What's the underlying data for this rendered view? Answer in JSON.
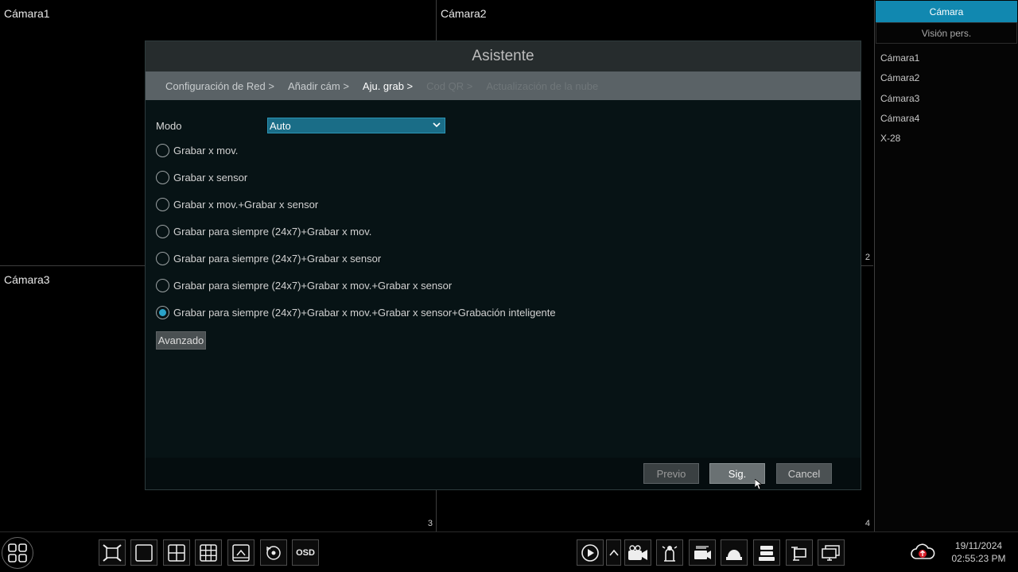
{
  "cameras": [
    {
      "title": "Cámara1",
      "num": ""
    },
    {
      "title": "Cámara2",
      "num": "2"
    },
    {
      "title": "Cámara3",
      "num": "3"
    },
    {
      "title": "",
      "num": "4"
    }
  ],
  "right_panel": {
    "tabs": [
      "Cámara",
      "Visión pers."
    ],
    "items": [
      "Cámara1",
      "Cámara2",
      "Cámara3",
      "Cámara4",
      "X-28"
    ]
  },
  "wizard": {
    "title": "Asistente",
    "steps": [
      {
        "label": "Configuración de Red >",
        "state": "done"
      },
      {
        "label": "Añadir cám >",
        "state": "done"
      },
      {
        "label": "Aju. grab >",
        "state": "current"
      },
      {
        "label": "Cod QR >",
        "state": "future"
      },
      {
        "label": "Actualización de la nube",
        "state": "future"
      }
    ],
    "mode_label": "Modo",
    "mode_value": "Auto",
    "options": [
      "Grabar x mov.",
      "Grabar x sensor",
      "Grabar x mov.+Grabar x sensor",
      "Grabar para siempre (24x7)+Grabar x mov.",
      "Grabar para siempre (24x7)+Grabar x sensor",
      "Grabar para siempre (24x7)+Grabar x mov.+Grabar x sensor",
      "Grabar para siempre (24x7)+Grabar x mov.+Grabar x sensor+Grabación inteligente"
    ],
    "selected_option": 6,
    "advanced_label": "Avanzado",
    "prev_label": "Previo",
    "next_label": "Sig.",
    "cancel_label": "Cancel"
  },
  "toolbar": {
    "osd_label": "OSD",
    "date": "19/11/2024",
    "time": "02:55:23 PM"
  },
  "colors": {
    "accent": "#1188b0",
    "select_bg": "#1a6d87"
  }
}
